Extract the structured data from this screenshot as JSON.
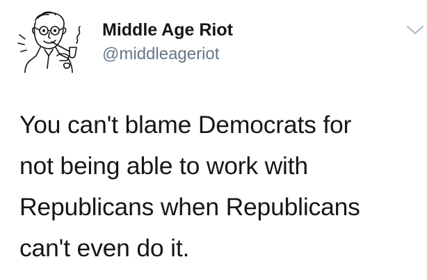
{
  "tweet": {
    "author": {
      "display_name": "Middle Age Riot",
      "handle": "@middleageriot",
      "avatar_icon": "cartoon-man-with-pipe-avatar"
    },
    "menu_icon": "chevron-down-icon",
    "text_lines": [
      "You can't blame Democrats for",
      "not being able to work with",
      "Republicans when Republicans",
      "can't even do it."
    ]
  },
  "colors": {
    "background": "#ffffff",
    "text": "#14171a",
    "handle": "#657786",
    "chevron": "#aab8c2"
  }
}
